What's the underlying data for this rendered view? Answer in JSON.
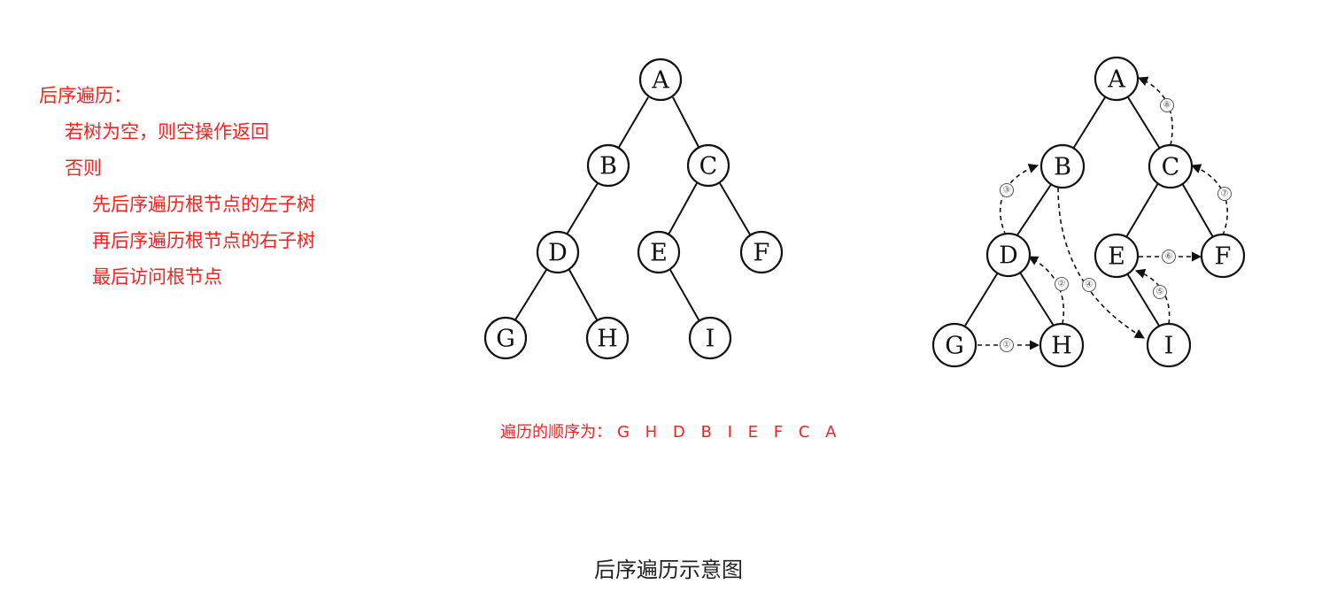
{
  "algorithm": {
    "title": "后序遍历：",
    "line1": "若树为空，则空操作返回",
    "line2": "否则",
    "line3": "先后序遍历根节点的左子树",
    "line4": "再后序遍历根节点的右子树",
    "line5": "最后访问根节点"
  },
  "tree_left": {
    "nodes": [
      "A",
      "B",
      "C",
      "D",
      "E",
      "F",
      "G",
      "H",
      "I"
    ]
  },
  "tree_right": {
    "nodes": [
      "A",
      "B",
      "C",
      "D",
      "E",
      "F",
      "G",
      "H",
      "I"
    ],
    "steps": [
      "①",
      "②",
      "③",
      "④",
      "⑤",
      "⑥",
      "⑦",
      "⑧"
    ]
  },
  "order": {
    "label": "遍历的顺序为：",
    "sequence": "G H D B I E F C A"
  },
  "caption": "后序遍历示意图"
}
